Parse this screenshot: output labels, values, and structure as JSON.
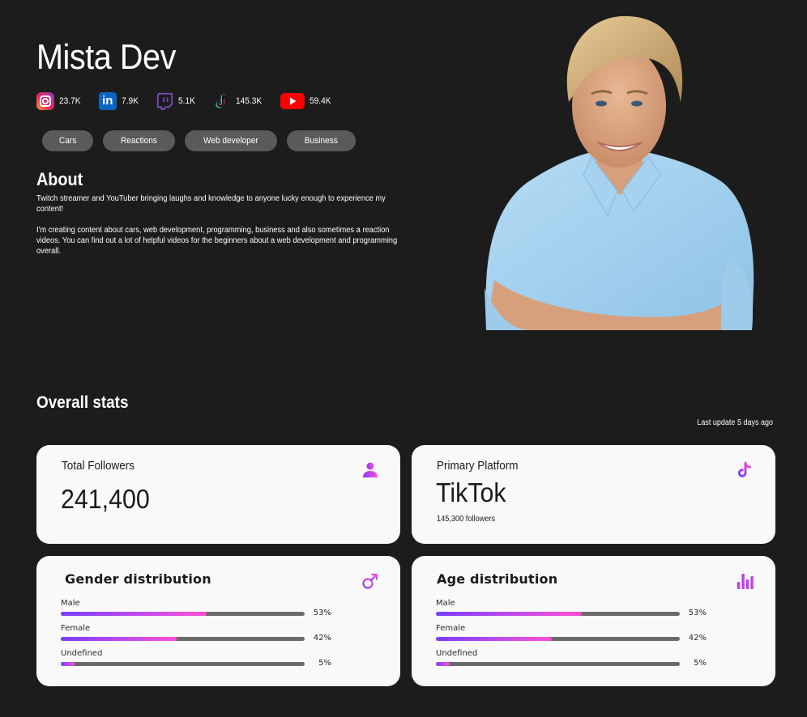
{
  "profile": {
    "name": "Mista Dev",
    "socials": [
      {
        "platform": "Instagram",
        "icon": "instagram-icon",
        "value": "23.7K"
      },
      {
        "platform": "LinkedIn",
        "icon": "linkedin-icon",
        "value": "7.9K"
      },
      {
        "platform": "Twitch",
        "icon": "twitch-icon",
        "value": "5.1K"
      },
      {
        "platform": "TikTok",
        "icon": "tiktok-icon",
        "value": "145.3K"
      },
      {
        "platform": "YouTube",
        "icon": "youtube-icon",
        "value": "59.4K"
      }
    ],
    "tags": [
      "Cars",
      "Reactions",
      "Web developer",
      "Business"
    ],
    "about": {
      "title": "About",
      "paragraphs": [
        "Twitch streamer and YouTuber bringing laughs and knowledge to anyone lucky enough to experience my content!",
        "I'm creating content about cars, web development, programming, business and also sometimes a reaction videos. You can find out a lot of helpful videos for the beginners about a web development and programming overall."
      ]
    },
    "linkedin_glyph": "in"
  },
  "stats": {
    "title": "Overall stats",
    "last_update": "Last update 5 days ago",
    "total_followers": {
      "label": "Total Followers",
      "value": "241,400",
      "icon": "user-icon"
    },
    "primary_platform": {
      "label": "Primary Platform",
      "value": "TikTok",
      "sub": "145,300 followers",
      "icon": "tiktok-icon"
    },
    "gender": {
      "title": "Gender distribution",
      "icon": "male-symbol-icon",
      "rows": [
        {
          "label": "Male",
          "percent": 53,
          "display": "53%"
        },
        {
          "label": "Female",
          "percent": 42,
          "display": "42%"
        },
        {
          "label": "Undefined",
          "percent": 5,
          "display": "5%"
        }
      ]
    },
    "age": {
      "title": "Age distribution",
      "icon": "bar-chart-icon",
      "rows": [
        {
          "label": "Male",
          "percent": 53,
          "display": "53%"
        },
        {
          "label": "Female",
          "percent": 42,
          "display": "42%"
        },
        {
          "label": "Undefined",
          "percent": 5,
          "display": "5%"
        }
      ]
    }
  },
  "colors": {
    "background": "#1c1c1c",
    "card": "#f9f9f9",
    "tag": "#5a5a5a",
    "accent_start": "#7a3cff",
    "accent_end": "#ff4fd2",
    "track": "#6b6b6b"
  }
}
